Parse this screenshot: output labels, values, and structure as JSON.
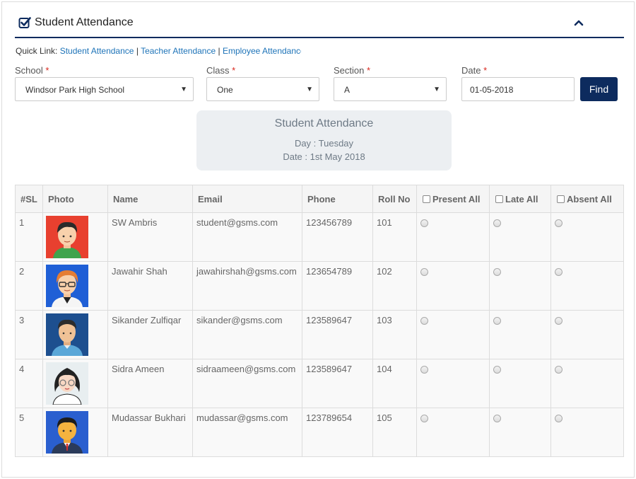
{
  "header": {
    "title": "Student Attendance"
  },
  "quick_links": {
    "prefix": "Quick Link:",
    "sep": "|",
    "items": [
      "Student Attendance",
      "Teacher Attendance",
      "Employee Attendance"
    ]
  },
  "filters": {
    "school": {
      "label": "School",
      "required": "*",
      "value": "Windsor Park High School"
    },
    "class": {
      "label": "Class",
      "required": "*",
      "value": "One"
    },
    "section": {
      "label": "Section",
      "required": "*",
      "value": "A"
    },
    "date": {
      "label": "Date",
      "required": "*",
      "value": "01-05-2018"
    },
    "find_label": "Find"
  },
  "summary": {
    "title": "Student Attendance",
    "day": "Day : Tuesday",
    "date": "Date : 1st May 2018"
  },
  "table": {
    "columns": [
      "#SL",
      "Photo",
      "Name",
      "Email",
      "Phone",
      "Roll No",
      "Present All",
      "Late All",
      "Absent All"
    ],
    "rows": [
      {
        "sl": "1",
        "name": "SW Ambris",
        "email": "student@gsms.com",
        "phone": "123456789",
        "roll": "101",
        "avatar": "avatar-boy-red"
      },
      {
        "sl": "2",
        "name": "Jawahir Shah",
        "email": "jawahirshah@gsms.com",
        "phone": "123654789",
        "roll": "102",
        "avatar": "avatar-glasses-blue"
      },
      {
        "sl": "3",
        "name": "Sikander Zulfiqar",
        "email": "sikander@gsms.com",
        "phone": "123589647",
        "roll": "103",
        "avatar": "avatar-man-navy"
      },
      {
        "sl": "4",
        "name": "Sidra Ameen",
        "email": "sidraameen@gsms.com",
        "phone": "123589647",
        "roll": "104",
        "avatar": "avatar-girl-glasses"
      },
      {
        "sl": "5",
        "name": "Mudassar Bukhari",
        "email": "mudassar@gsms.com",
        "phone": "123789654",
        "roll": "105",
        "avatar": "avatar-suit-blue"
      }
    ]
  },
  "colors": {
    "accent": "#0d2b5e",
    "link": "#1d73b8",
    "required": "#d9261c"
  }
}
